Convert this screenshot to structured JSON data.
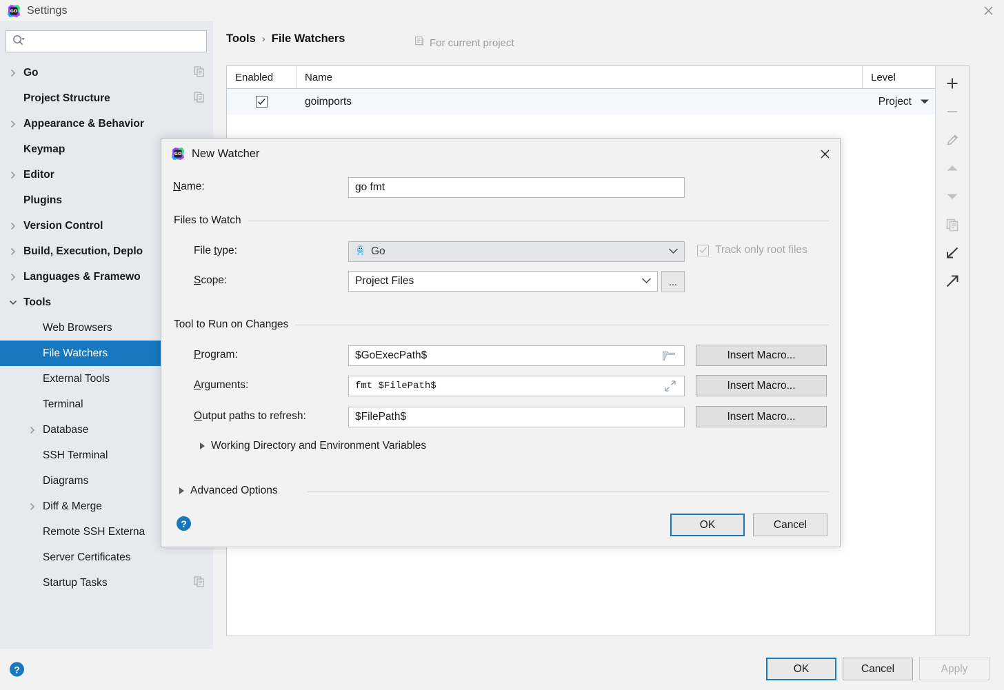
{
  "window": {
    "title": "Settings",
    "app_icon": "goland-icon",
    "close_icon": "close-icon"
  },
  "search": {
    "placeholder": "",
    "value": "",
    "icon": "search-icon"
  },
  "sidebar": {
    "items": [
      {
        "label": "Go",
        "level": 0,
        "arrow": "right",
        "badge": "copy-icon"
      },
      {
        "label": "Project Structure",
        "level": 0,
        "arrow": "none",
        "badge": "copy-icon"
      },
      {
        "label": "Appearance & Behavior",
        "level": 0,
        "arrow": "right",
        "badge": ""
      },
      {
        "label": "Keymap",
        "level": 0,
        "arrow": "none",
        "badge": ""
      },
      {
        "label": "Editor",
        "level": 0,
        "arrow": "right",
        "badge": ""
      },
      {
        "label": "Plugins",
        "level": 0,
        "arrow": "none",
        "badge": ""
      },
      {
        "label": "Version Control",
        "level": 0,
        "arrow": "right",
        "badge": ""
      },
      {
        "label": "Build, Execution, Deplo",
        "level": 0,
        "arrow": "right",
        "badge": ""
      },
      {
        "label": "Languages & Framewo",
        "level": 0,
        "arrow": "right",
        "badge": ""
      },
      {
        "label": "Tools",
        "level": 0,
        "arrow": "down",
        "badge": ""
      },
      {
        "label": "Web Browsers",
        "level": 1,
        "arrow": "none",
        "badge": ""
      },
      {
        "label": "File Watchers",
        "level": 1,
        "arrow": "none",
        "badge": "",
        "selected": true
      },
      {
        "label": "External Tools",
        "level": 1,
        "arrow": "none",
        "badge": ""
      },
      {
        "label": "Terminal",
        "level": 1,
        "arrow": "none",
        "badge": ""
      },
      {
        "label": "Database",
        "level": 1,
        "arrow": "right",
        "badge": ""
      },
      {
        "label": "SSH Terminal",
        "level": 1,
        "arrow": "none",
        "badge": ""
      },
      {
        "label": "Diagrams",
        "level": 1,
        "arrow": "none",
        "badge": ""
      },
      {
        "label": "Diff & Merge",
        "level": 1,
        "arrow": "right",
        "badge": ""
      },
      {
        "label": "Remote SSH Externa",
        "level": 1,
        "arrow": "none",
        "badge": ""
      },
      {
        "label": "Server Certificates",
        "level": 1,
        "arrow": "none",
        "badge": ""
      },
      {
        "label": "Startup Tasks",
        "level": 1,
        "arrow": "none",
        "badge": "copy-icon"
      }
    ]
  },
  "main": {
    "breadcrumb": {
      "parent": "Tools",
      "separator": "›",
      "current": "File Watchers"
    },
    "scope_note": {
      "icon": "project-scope-icon",
      "text": "For current project"
    },
    "table": {
      "columns": [
        "Enabled",
        "Name",
        "Level"
      ],
      "rows": [
        {
          "enabled": true,
          "name": "goimports",
          "level": "Project",
          "level_caret": "caret-down-icon"
        }
      ]
    },
    "toolbar": [
      {
        "name": "add-button",
        "glyph": "+",
        "enabled": true
      },
      {
        "name": "remove-button",
        "glyph": "−",
        "enabled": false
      },
      {
        "name": "edit-button",
        "glyph": "pencil-icon",
        "enabled": false
      },
      {
        "name": "move-up-button",
        "glyph": "triangle-up-icon",
        "enabled": false
      },
      {
        "name": "move-down-button",
        "glyph": "triangle-down-icon",
        "enabled": false
      },
      {
        "name": "copy-button",
        "glyph": "copy-icon",
        "enabled": false
      },
      {
        "name": "import-button",
        "glyph": "import-icon",
        "enabled": true
      },
      {
        "name": "export-button",
        "glyph": "export-icon",
        "enabled": true
      }
    ]
  },
  "bottom": {
    "help_icon": "help-icon",
    "ok": "OK",
    "cancel": "Cancel",
    "apply": "Apply",
    "apply_disabled": true
  },
  "dialog": {
    "icon": "goland-icon",
    "title": "New Watcher",
    "close_icon": "close-icon",
    "name": {
      "label": "Name:",
      "mnemonic": "N",
      "value": "go fmt"
    },
    "files_to_watch": {
      "legend": "Files to Watch",
      "file_type": {
        "label_pre": "File ",
        "label_mnemonic": "t",
        "label_post": "ype:",
        "value": "Go",
        "icon": "go-gopher-icon",
        "disabled": true,
        "caret": "chevron-down-icon"
      },
      "track_only_root_files": {
        "label": "Track only root files",
        "checked": true,
        "disabled": true
      },
      "scope": {
        "label_mnemonic": "S",
        "label_post": "cope:",
        "value": "Project Files",
        "caret": "chevron-down-icon",
        "browse_label": "..."
      }
    },
    "tool_to_run": {
      "legend": "Tool to Run on Changes",
      "program": {
        "label_mnemonic": "P",
        "label_post": "rogram:",
        "value": "$GoExecPath$",
        "icon": "folder-icon",
        "macro_button": "Insert Macro..."
      },
      "arguments": {
        "label_mnemonic": "A",
        "label_post": "rguments:",
        "value": "fmt $FilePath$",
        "icon": "expand-diagonal-icon",
        "macro_button": "Insert Macro..."
      },
      "output_paths": {
        "label_mnemonic": "O",
        "label_post": "utput paths to refresh:",
        "value": "$FilePath$",
        "macro_button": "Insert Macro..."
      },
      "working_directory": {
        "label": "Working Directory and Environment Variables",
        "expanded": false,
        "icon": "triangle-right-icon"
      }
    },
    "advanced_options": {
      "label": "Advanced Options",
      "expanded": false,
      "icon": "triangle-right-icon"
    },
    "footer": {
      "help_icon": "help-icon",
      "ok": "OK",
      "cancel": "Cancel"
    }
  },
  "colors": {
    "accent": "#1878bf",
    "sidebar_bg": "#e6eaee",
    "panel_bg": "#f2f2f2",
    "selected_row_bg": "#f4f8fc",
    "disabled_text": "#a6a6a6"
  }
}
